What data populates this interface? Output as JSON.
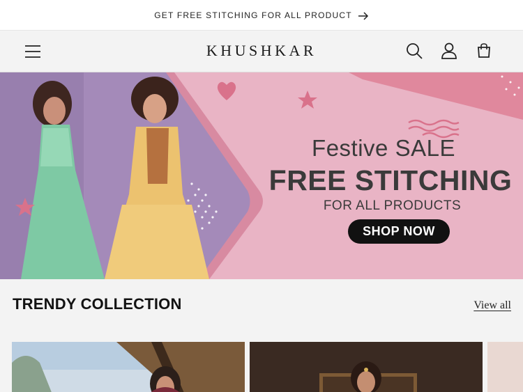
{
  "announcement": {
    "text": "GET FREE STITCHING FOR ALL PRODUCT",
    "arrow_icon": "arrow-right-icon"
  },
  "header": {
    "logo": "KHUSHKAR",
    "icons": [
      "menu-icon",
      "search-icon",
      "account-icon",
      "cart-icon"
    ]
  },
  "banner": {
    "subtitle": "Festive SALE",
    "title": "FREE STITCHING",
    "caption": "FOR ALL PRODUCTS",
    "button_label": "SHOP NOW",
    "colors": {
      "background": "#e9b4c5",
      "accent": "#e0889d",
      "text": "#3a3a3a",
      "button": "#111111"
    }
  },
  "collection": {
    "title": "TRENDY COLLECTION",
    "view_all_label": "View all"
  }
}
